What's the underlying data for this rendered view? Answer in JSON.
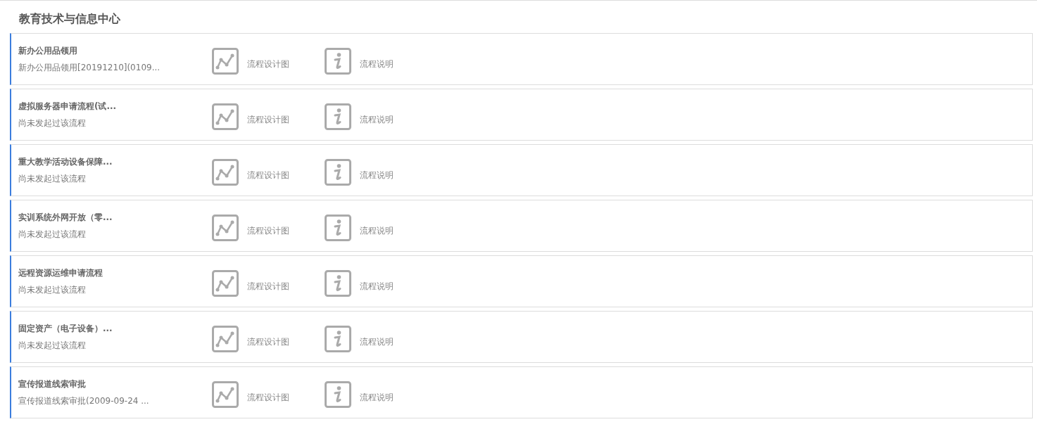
{
  "section": {
    "title": "教育技术与信息中心"
  },
  "processes": [
    {
      "name": "新办公用品领用",
      "detail": "新办公用品领用[20191210](0109...",
      "design_label": "流程设计图",
      "info_label": "流程说明"
    },
    {
      "name": "虚拟服务器申请流程(试...",
      "detail": "尚未发起过该流程",
      "design_label": "流程设计图",
      "info_label": "流程说明"
    },
    {
      "name": "重大教学活动设备保障...",
      "detail": "尚未发起过该流程",
      "design_label": "流程设计图",
      "info_label": "流程说明"
    },
    {
      "name": "实训系统外网开放（零...",
      "detail": "尚未发起过该流程",
      "design_label": "流程设计图",
      "info_label": "流程说明"
    },
    {
      "name": "远程资源运维申请流程",
      "detail": "尚未发起过该流程",
      "design_label": "流程设计图",
      "info_label": "流程说明"
    },
    {
      "name": "固定资产（电子设备）...",
      "detail": "尚未发起过该流程",
      "design_label": "流程设计图",
      "info_label": "流程说明"
    },
    {
      "name": "宣传报道线索审批",
      "detail": "宣传报道线索审批(2009-09-24 ...",
      "design_label": "流程设计图",
      "info_label": "流程说明"
    }
  ]
}
